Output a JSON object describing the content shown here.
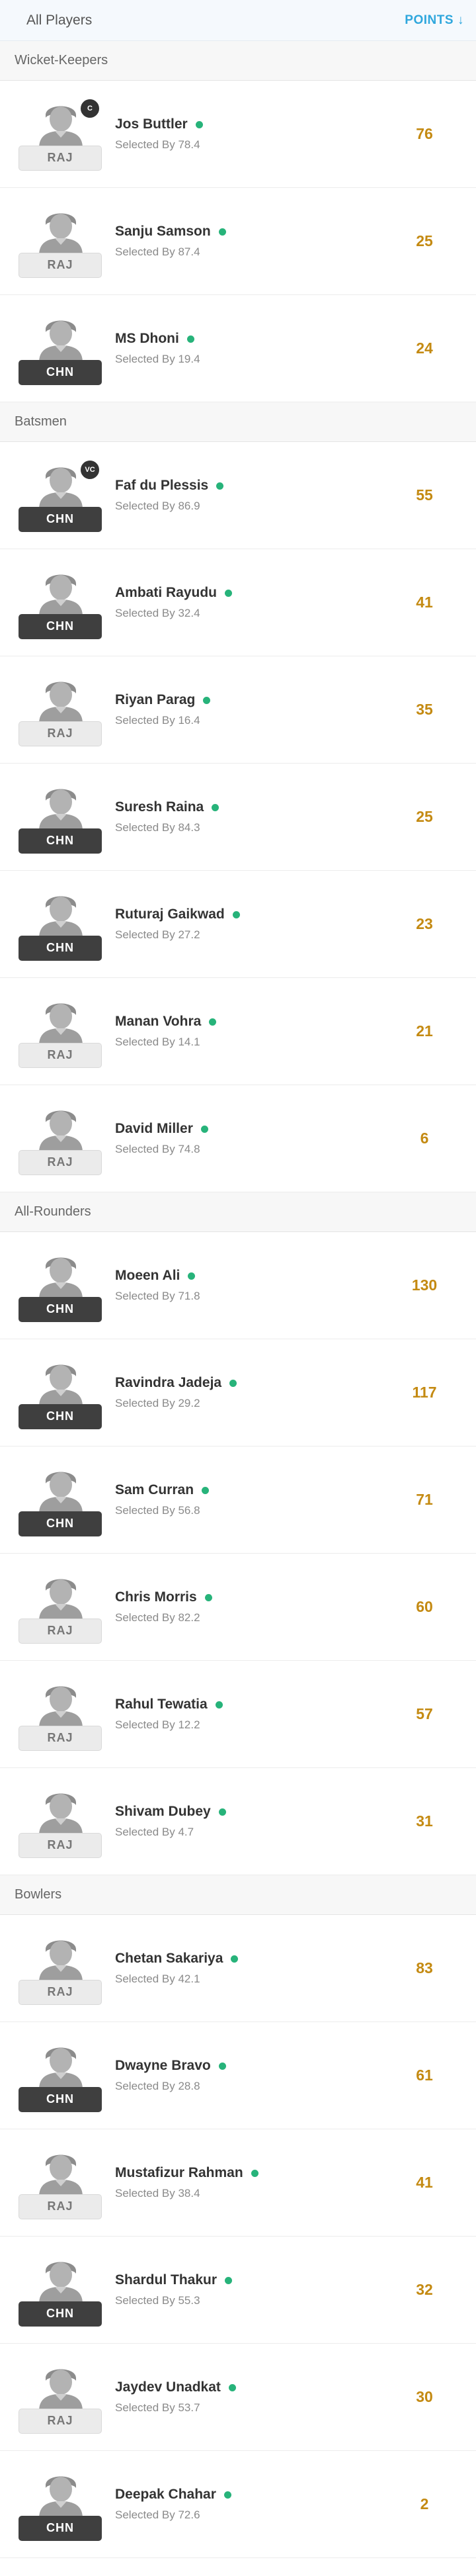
{
  "header": {
    "left": "All Players",
    "right": "POINTS",
    "sort_icon": "arrow-down-icon"
  },
  "sections": [
    {
      "title": "Wicket-Keepers",
      "players": [
        {
          "name": "Jos Buttler",
          "selected": "Selected By 78.4",
          "points": "76",
          "team": "RAJ",
          "badge": "C"
        },
        {
          "name": "Sanju Samson",
          "selected": "Selected By 87.4",
          "points": "25",
          "team": "RAJ"
        },
        {
          "name": "MS Dhoni",
          "selected": "Selected By 19.4",
          "points": "24",
          "team": "CHN"
        }
      ]
    },
    {
      "title": "Batsmen",
      "players": [
        {
          "name": "Faf du Plessis",
          "selected": "Selected By 86.9",
          "points": "55",
          "team": "CHN",
          "badge": "VC"
        },
        {
          "name": "Ambati Rayudu",
          "selected": "Selected By 32.4",
          "points": "41",
          "team": "CHN"
        },
        {
          "name": "Riyan Parag",
          "selected": "Selected By 16.4",
          "points": "35",
          "team": "RAJ"
        },
        {
          "name": "Suresh Raina",
          "selected": "Selected By 84.3",
          "points": "25",
          "team": "CHN"
        },
        {
          "name": "Ruturaj Gaikwad",
          "selected": "Selected By 27.2",
          "points": "23",
          "team": "CHN"
        },
        {
          "name": "Manan Vohra",
          "selected": "Selected By 14.1",
          "points": "21",
          "team": "RAJ"
        },
        {
          "name": "David Miller",
          "selected": "Selected By 74.8",
          "points": "6",
          "team": "RAJ"
        }
      ]
    },
    {
      "title": "All-Rounders",
      "players": [
        {
          "name": "Moeen Ali",
          "selected": "Selected By 71.8",
          "points": "130",
          "team": "CHN"
        },
        {
          "name": "Ravindra Jadeja",
          "selected": "Selected By 29.2",
          "points": "117",
          "team": "CHN"
        },
        {
          "name": "Sam Curran",
          "selected": "Selected By 56.8",
          "points": "71",
          "team": "CHN"
        },
        {
          "name": "Chris Morris",
          "selected": "Selected By 82.2",
          "points": "60",
          "team": "RAJ"
        },
        {
          "name": "Rahul Tewatia",
          "selected": "Selected By 12.2",
          "points": "57",
          "team": "RAJ"
        },
        {
          "name": "Shivam Dubey",
          "selected": "Selected By 4.7",
          "points": "31",
          "team": "RAJ"
        }
      ]
    },
    {
      "title": "Bowlers",
      "players": [
        {
          "name": "Chetan Sakariya",
          "selected": "Selected By 42.1",
          "points": "83",
          "team": "RAJ"
        },
        {
          "name": "Dwayne Bravo",
          "selected": "Selected By 28.8",
          "points": "61",
          "team": "CHN"
        },
        {
          "name": "Mustafizur Rahman",
          "selected": "Selected By 38.4",
          "points": "41",
          "team": "RAJ"
        },
        {
          "name": "Shardul Thakur",
          "selected": "Selected By 55.3",
          "points": "32",
          "team": "CHN"
        },
        {
          "name": "Jaydev Unadkat",
          "selected": "Selected By 53.7",
          "points": "30",
          "team": "RAJ"
        },
        {
          "name": "Deepak Chahar",
          "selected": "Selected By 72.6",
          "points": "2",
          "team": "CHN"
        }
      ]
    }
  ],
  "colors": {
    "accent": "#2fa7dd",
    "points": "#c48a12",
    "status_dot": "#27b37a",
    "team_chn": "#3f3f3f",
    "team_raj": "#ebebeb"
  }
}
